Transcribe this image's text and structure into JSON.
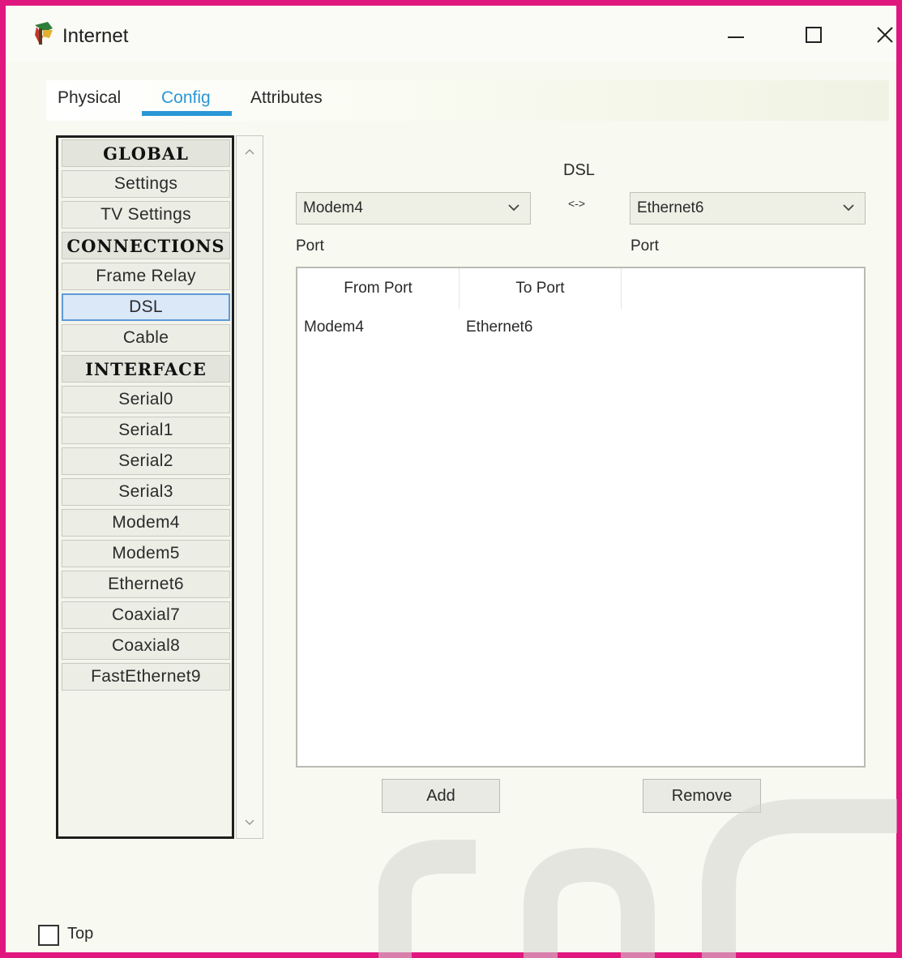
{
  "window": {
    "title": "Internet",
    "minimize": "—",
    "maximize": "☐",
    "close": "✕"
  },
  "tabs": [
    {
      "label": "Physical"
    },
    {
      "label": "Config"
    },
    {
      "label": "Attributes"
    }
  ],
  "sidebar": {
    "items": [
      {
        "label": "GLOBAL"
      },
      {
        "label": "Settings"
      },
      {
        "label": "TV Settings"
      },
      {
        "label": "CONNECTIONS"
      },
      {
        "label": "Frame Relay"
      },
      {
        "label": "DSL"
      },
      {
        "label": "Cable"
      },
      {
        "label": "INTERFACE"
      },
      {
        "label": "Serial0"
      },
      {
        "label": "Serial1"
      },
      {
        "label": "Serial2"
      },
      {
        "label": "Serial3"
      },
      {
        "label": "Modem4"
      },
      {
        "label": "Modem5"
      },
      {
        "label": "Ethernet6"
      },
      {
        "label": "Coaxial7"
      },
      {
        "label": "Coaxial8"
      },
      {
        "label": "FastEthernet9"
      }
    ]
  },
  "connection": {
    "type_label": "DSL",
    "arrow": "<->",
    "from_select": "Modem4",
    "to_select": "Ethernet6",
    "from_port_label": "Port",
    "to_port_label": "Port"
  },
  "table": {
    "headers": {
      "from": "From Port",
      "to": "To Port"
    },
    "rows": [
      {
        "from": "Modem4",
        "to": "Ethernet6"
      }
    ]
  },
  "buttons": {
    "add": "Add",
    "remove": "Remove"
  },
  "footer": {
    "top_label": "Top"
  },
  "colors": {
    "frame_border": "#e0177f",
    "active_tab": "#2a97d6",
    "selected_item_bg": "#dbe8f7"
  }
}
